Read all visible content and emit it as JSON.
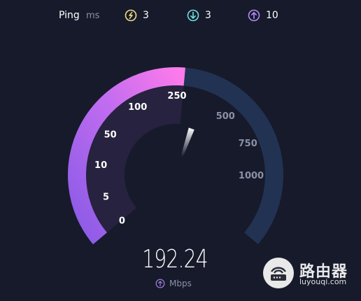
{
  "header": {
    "ping_label": "Ping",
    "ping_unit": "ms",
    "jitter_value": "3",
    "download_value": "3",
    "upload_value": "10"
  },
  "gauge": {
    "scale_labels": [
      "0",
      "5",
      "10",
      "50",
      "100",
      "250",
      "500",
      "750",
      "1000"
    ],
    "needle_value": 192.24,
    "progress_fraction": 0.52,
    "colors": {
      "track": "#223253",
      "progress_start": "#8a5ae6",
      "progress_end": "#ff7bea",
      "label_active": "#ffffff",
      "label_inactive": "#8b90a6"
    }
  },
  "result": {
    "speed": "192.24",
    "unit": "Mbps",
    "direction_icon": "upload-arrow-icon"
  },
  "watermark": {
    "title": "路由器",
    "domain": "luyouqi.com"
  }
}
